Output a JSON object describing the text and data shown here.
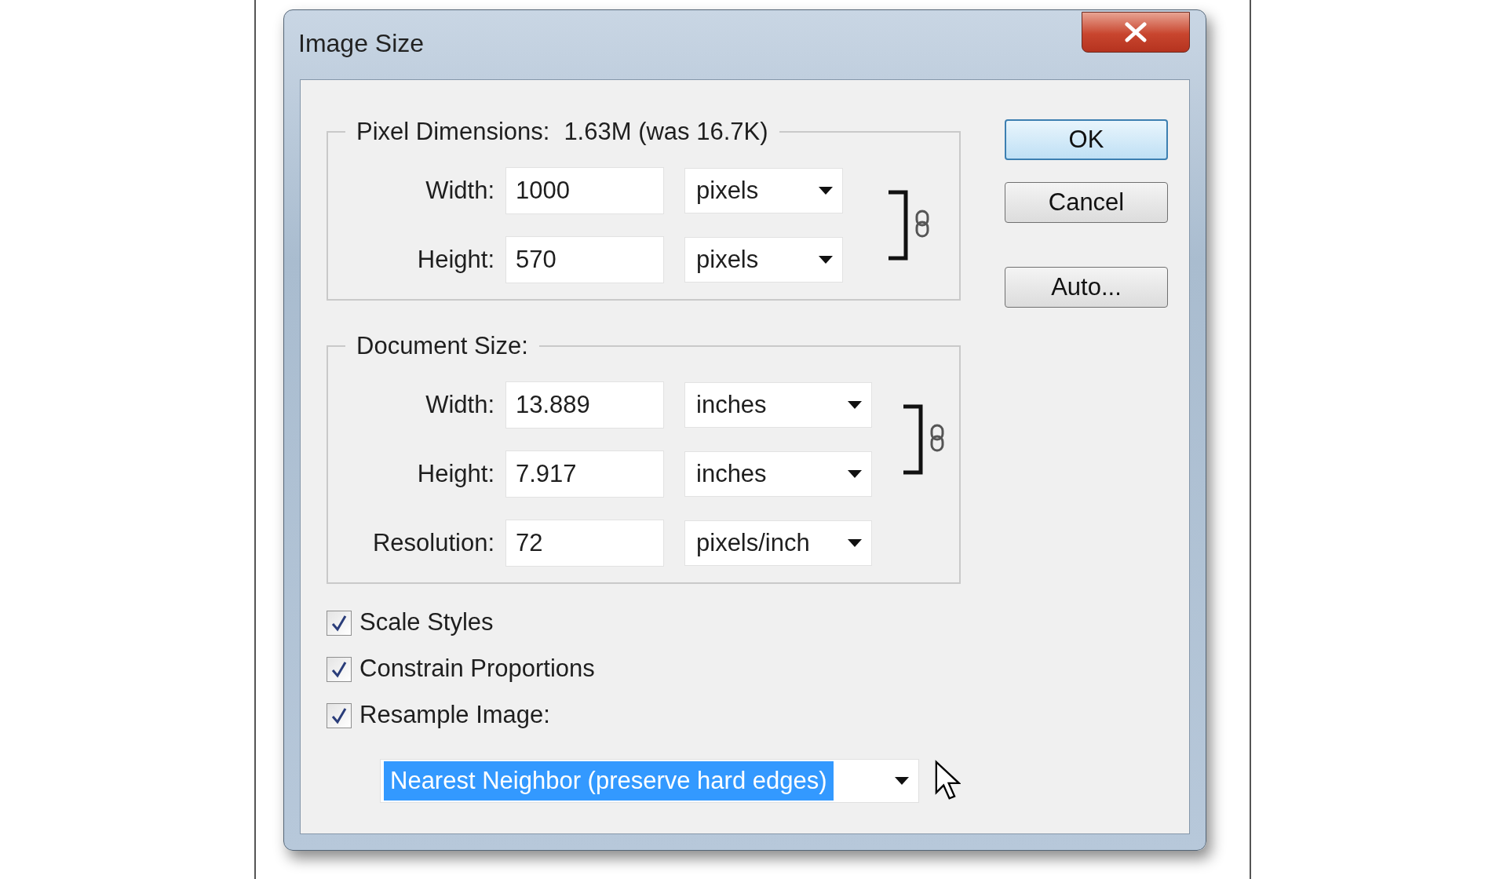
{
  "window": {
    "title": "Image Size"
  },
  "pixel_dimensions": {
    "label": "Pixel Dimensions:",
    "value": "1.63M (was 16.7K)",
    "linked": true,
    "fields": [
      {
        "label": "Width:",
        "value": "1000",
        "unit": "pixels"
      },
      {
        "label": "Height:",
        "value": "570",
        "unit": "pixels"
      }
    ]
  },
  "document_size": {
    "label": "Document Size:",
    "linked": true,
    "fields": [
      {
        "label": "Width:",
        "value": "13.889",
        "unit": "inches"
      },
      {
        "label": "Height:",
        "value": "7.917",
        "unit": "inches"
      },
      {
        "label": "Resolution:",
        "value": "72",
        "unit": "pixels/inch"
      }
    ]
  },
  "options": [
    {
      "label": "Scale Styles",
      "checked": true
    },
    {
      "label": "Constrain Proportions",
      "checked": true
    },
    {
      "label": "Resample Image:",
      "checked": true
    }
  ],
  "resample": {
    "value": "Nearest Neighbor (preserve hard edges)",
    "text_selected": true
  },
  "buttons": [
    {
      "label": "OK",
      "default": true
    },
    {
      "label": "Cancel",
      "default": false
    },
    {
      "label": "Auto...",
      "default": false
    }
  ]
}
